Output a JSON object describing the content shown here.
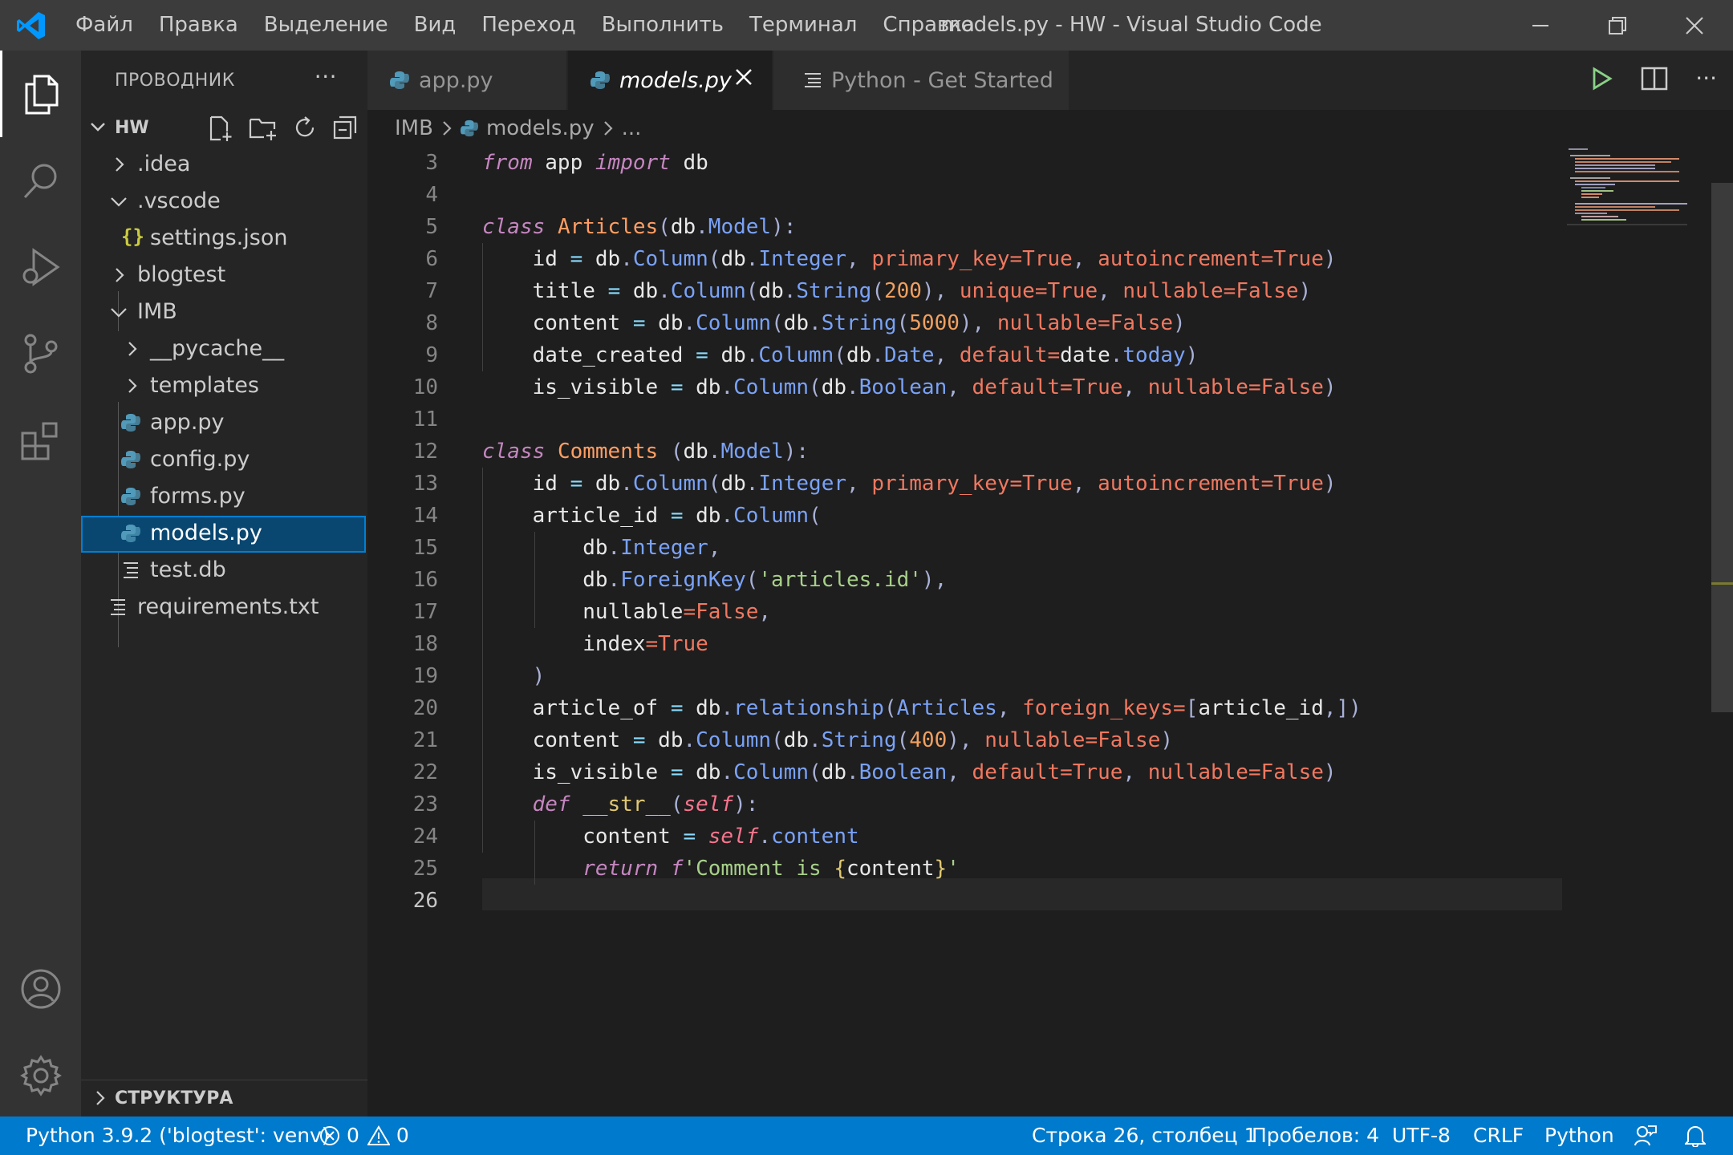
{
  "titlebar": {
    "menu": [
      "Файл",
      "Правка",
      "Выделение",
      "Вид",
      "Переход",
      "Выполнить",
      "Терминал",
      "Справка"
    ],
    "title": "models.py - HW - Visual Studio Code"
  },
  "sidebar": {
    "title": "ПРОВОДНИК",
    "more": "···",
    "folder": "HW",
    "tree": [
      {
        "label": ".idea",
        "type": "folder-collapsed"
      },
      {
        "label": ".vscode",
        "type": "folder-expanded"
      },
      {
        "label": "settings.json",
        "type": "json"
      },
      {
        "label": "blogtest",
        "type": "folder-collapsed"
      },
      {
        "label": "IMB",
        "type": "folder-expanded"
      },
      {
        "label": "__pycache__",
        "type": "folder-collapsed"
      },
      {
        "label": "templates",
        "type": "folder-collapsed"
      },
      {
        "label": "app.py",
        "type": "python"
      },
      {
        "label": "config.py",
        "type": "python"
      },
      {
        "label": "forms.py",
        "type": "python"
      },
      {
        "label": "models.py",
        "type": "python",
        "selected": true
      },
      {
        "label": "test.db",
        "type": "text"
      },
      {
        "label": "requirements.txt",
        "type": "text"
      }
    ],
    "outline": "СТРУКТУРА"
  },
  "tabs": [
    {
      "label": "app.py",
      "active": false
    },
    {
      "label": "models.py",
      "active": true
    },
    {
      "label": "Python - Get Started",
      "active": false
    }
  ],
  "breadcrumb": {
    "folder": "IMB",
    "file": "models.py",
    "tail": "..."
  },
  "editor": {
    "line_numbers": [
      "3",
      "4",
      "5",
      "6",
      "7",
      "8",
      "9",
      "10",
      "11",
      "12",
      "13",
      "14",
      "15",
      "16",
      "17",
      "18",
      "19",
      "20",
      "21",
      "22",
      "23",
      "24",
      "25",
      "26"
    ],
    "current_line": "26",
    "code_lines": [
      "from app import db",
      "",
      "class Articles(db.Model):",
      "    id = db.Column(db.Integer, primary_key=True, autoincrement=True)",
      "    title = db.Column(db.String(200), unique=True, nullable=False)",
      "    content = db.Column(db.String(5000), nullable=False)",
      "    date_created = db.Column(db.Date, default=date.today)",
      "    is_visible = db.Column(db.Boolean, default=True, nullable=False)",
      "",
      "class Comments (db.Model):",
      "    id = db.Column(db.Integer, primary_key=True, autoincrement=True)",
      "    article_id = db.Column(",
      "        db.Integer,",
      "        db.ForeignKey('articles.id'),",
      "        nullable=False,",
      "        index=True",
      "    )",
      "    article_of = db.relationship(Articles, foreign_keys=[article_id,])",
      "    content = db.Column(db.String(400), nullable=False)",
      "    is_visible = db.Column(db.Boolean, default=True, nullable=False)",
      "    def __str__(self):",
      "        content = self.content",
      "        return f'Comment is {content}'",
      ""
    ]
  },
  "statusbar": {
    "interpreter": "Python 3.9.2  ('blogtest': venv)",
    "errors": "0",
    "warnings": "0",
    "position": "Строка 26, столбец 1",
    "spaces": "Пробелов: 4",
    "encoding": "UTF-8",
    "eol": "CRLF",
    "language": "Python"
  },
  "colors": {
    "accent": "#007acc",
    "selection": "#094771",
    "titlebar": "#3c3c3c",
    "sidebar": "#252526",
    "editor": "#1e1e1e"
  }
}
